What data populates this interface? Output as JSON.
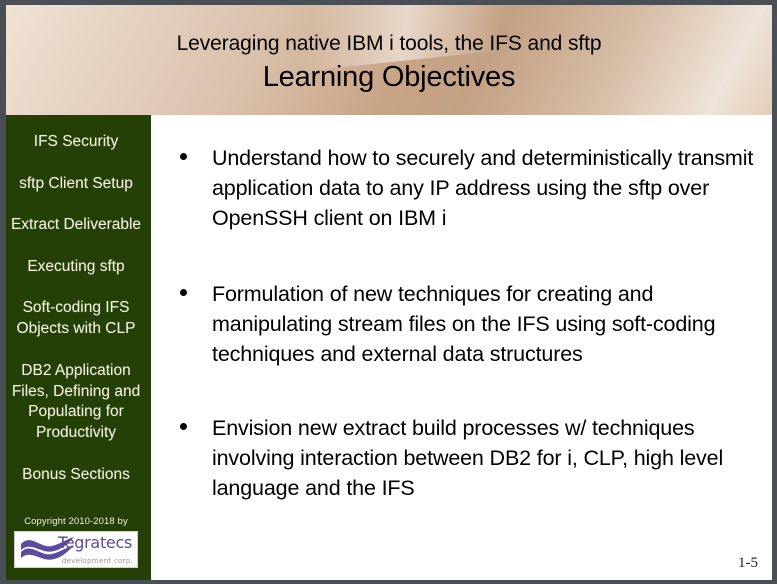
{
  "slide": {
    "header": {
      "subtitle": "Leveraging native IBM i tools, the IFS and sftp",
      "title": "Learning Objectives"
    },
    "page_number": "1-5",
    "colors": {
      "sidebar_green": "#254006",
      "sidebar_text": "#f3f3e2",
      "header_tan": "#c8a486",
      "border_gray": "#4a4f56",
      "logo_purple": "#5b4a9e",
      "body_text": "#000000"
    }
  },
  "sidebar": {
    "items": [
      {
        "label": "IFS Security"
      },
      {
        "label": "sftp Client Setup"
      },
      {
        "label": "Extract Deliverable"
      },
      {
        "label": "Executing sftp"
      },
      {
        "label": "Soft-coding IFS Objects with CLP"
      },
      {
        "label": "DB2 Application Files, Defining and Populating for Productivity"
      },
      {
        "label": "Bonus Sections"
      }
    ],
    "copyright": "Copyright 2010-2018 by",
    "logo": {
      "name": "Tegratecs",
      "tagline": "development corp."
    }
  },
  "content": {
    "bullets": [
      {
        "text": "Understand how to securely and deterministically transmit application data to any IP address using the sftp over OpenSSH client on IBM i"
      },
      {
        "text": "Formulation of new techniques for creating and manipulating stream files on the IFS using soft-coding techniques and external data structures"
      },
      {
        "text": "Envision new extract build processes w/ techniques involving interaction between DB2 for i, CLP, high level language and the IFS"
      }
    ]
  }
}
